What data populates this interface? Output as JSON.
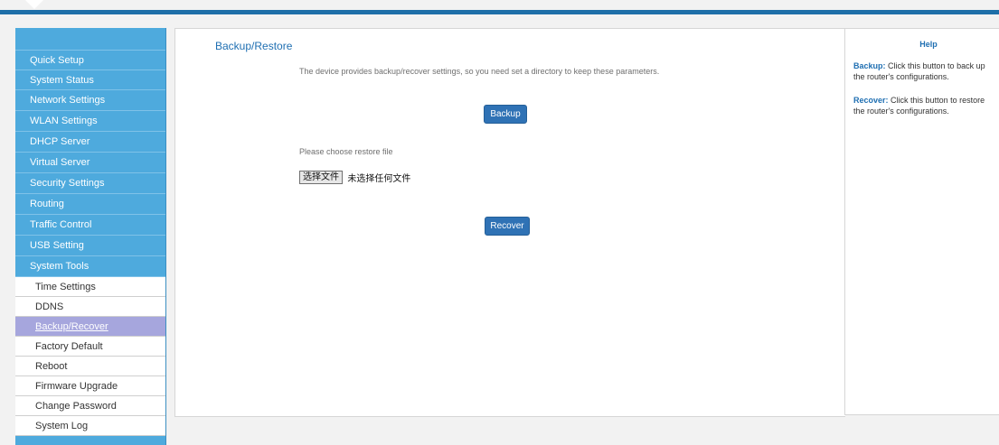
{
  "sidebar": {
    "items": [
      {
        "label": "Quick Setup"
      },
      {
        "label": "System Status"
      },
      {
        "label": "Network Settings"
      },
      {
        "label": "WLAN Settings"
      },
      {
        "label": "DHCP Server"
      },
      {
        "label": "Virtual Server"
      },
      {
        "label": "Security Settings"
      },
      {
        "label": "Routing"
      },
      {
        "label": "Traffic Control"
      },
      {
        "label": "USB Setting"
      },
      {
        "label": "System Tools"
      }
    ],
    "sub_items": [
      {
        "label": "Time Settings"
      },
      {
        "label": "DDNS"
      },
      {
        "label": "Backup/Recover",
        "active": true
      },
      {
        "label": "Factory Default"
      },
      {
        "label": "Reboot"
      },
      {
        "label": "Firmware Upgrade"
      },
      {
        "label": "Change Password"
      },
      {
        "label": "System Log"
      }
    ]
  },
  "main": {
    "title": "Backup/Restore",
    "description": "The device provides backup/recover settings, so you need set a directory to keep these parameters.",
    "backup_button": "Backup",
    "choose_label": "Please choose restore file",
    "file_button": "选择文件",
    "file_status": "未选择任何文件",
    "recover_button": "Recover"
  },
  "help": {
    "title": "Help",
    "backup_term": "Backup:",
    "backup_text": "Click this button to back up the router's configurations.",
    "recover_term": "Recover:",
    "recover_text": "Click this button to restore the router's configurations."
  },
  "colors": {
    "accent": "#1e6fa8",
    "sidebar": "#4eaadd",
    "active_item": "#a6a6dd",
    "button": "#2f72b5"
  }
}
